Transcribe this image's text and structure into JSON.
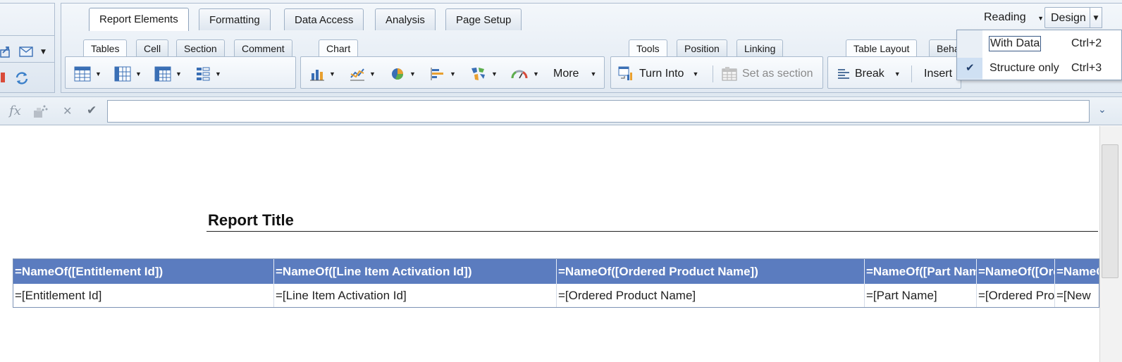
{
  "main_tabs": [
    "Report Elements",
    "Formatting",
    "Data Access",
    "Analysis",
    "Page Setup"
  ],
  "view_modes": {
    "reading": "Reading",
    "design": "Design"
  },
  "view_menu": {
    "items": [
      {
        "label": "With Data",
        "shortcut": "Ctrl+2"
      },
      {
        "label": "Structure only",
        "shortcut": "Ctrl+3",
        "checked": "✔"
      }
    ]
  },
  "sub_tabs": {
    "tables_group": [
      "Tables",
      "Cell",
      "Section",
      "Comment"
    ],
    "chart_group": [
      "Chart"
    ],
    "tools_group": [
      "Tools",
      "Position",
      "Linking"
    ],
    "layout_group": [
      "Table Layout",
      "Beha"
    ]
  },
  "chart_toolbar": {
    "more": "More"
  },
  "tools_toolbar": {
    "turn_into": "Turn Into",
    "set_as_section": "Set as section"
  },
  "layout_toolbar": {
    "break": "Break",
    "insert": "Insert"
  },
  "formula_bar": {
    "fx": "fx",
    "cancel": "✕",
    "accept": "✔",
    "value": ""
  },
  "report": {
    "title": "Report Title",
    "headers": [
      "=NameOf([Entitlement Id])",
      "=NameOf([Line Item Activation Id])",
      "=NameOf([Ordered Product Name])",
      "=NameOf([Part Name])",
      "=NameOf([Ordered Product Name])",
      "=NameOf([New"
    ],
    "cells": [
      "=[Entitlement Id]",
      "=[Line Item Activation Id]",
      "=[Ordered Product Name]",
      "=[Part Name]",
      "=[Ordered Product Name]",
      " =[New"
    ]
  },
  "colors": {
    "header_bg": "#5b7cbf",
    "header_text": "#ffffff",
    "ribbon": "#e1e9f2"
  }
}
